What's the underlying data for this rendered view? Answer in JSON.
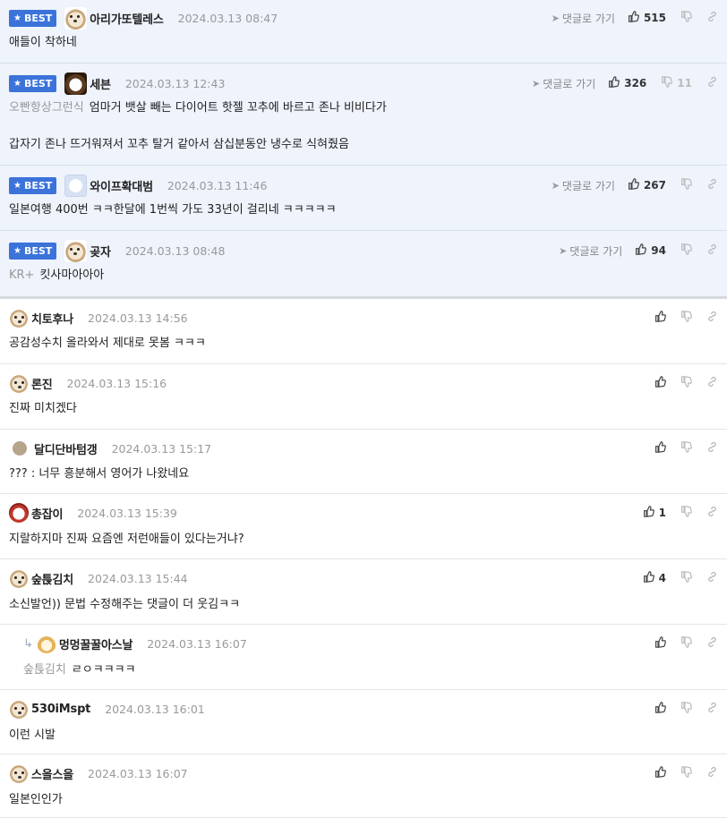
{
  "ui": {
    "best_label": "BEST",
    "goto_label": "댓글로 가기"
  },
  "comments": [
    {
      "best": true,
      "nick": "아리가또텔레스",
      "date": "2024.03.13 08:47",
      "likes": "515",
      "dislikes": "",
      "prefix": "",
      "text": "애들이 착하네",
      "text2": "",
      "avatar_icon": "dog-avatar-icon"
    },
    {
      "best": true,
      "nick": "세븐",
      "date": "2024.03.13 12:43",
      "likes": "326",
      "dislikes": "11",
      "prefix": "오빤항상그런식",
      "text": "엄마거 뱃살 빼는 다이어트 핫젤 꼬추에 바르고 존나 비비다가",
      "text2": "갑자기 존나 뜨거워져서 꼬추 탈거 같아서 삼십분동안 냉수로 식혀줬음",
      "avatar_icon": "dark-dog-avatar-icon"
    },
    {
      "best": true,
      "nick": "와이프확대범",
      "date": "2024.03.13 11:46",
      "likes": "267",
      "dislikes": "",
      "prefix": "",
      "text": "일본여행 400번 ㅋㅋ한달에 1번씩 가도 33년이 걸리네 ㅋㅋㅋㅋㅋ",
      "text2": "",
      "avatar_icon": "white-dog-avatar-icon"
    },
    {
      "best": true,
      "nick": "곶자",
      "date": "2024.03.13 08:48",
      "likes": "94",
      "dislikes": "",
      "prefix": "KR+",
      "text": "킷사마아아아",
      "text2": "",
      "avatar_icon": "dog-avatar-icon"
    },
    {
      "best": false,
      "nick": "치토후나",
      "date": "2024.03.13 14:56",
      "likes": "",
      "dislikes": "",
      "prefix": "",
      "text": "공감성수치 올라와서 제대로 못봄 ㅋㅋㅋ",
      "text2": "",
      "avatar_icon": "dog-avatar-icon"
    },
    {
      "best": false,
      "nick": "론진",
      "date": "2024.03.13 15:16",
      "likes": "",
      "dislikes": "",
      "prefix": "",
      "text": "진짜 미치겠다",
      "text2": "",
      "avatar_icon": "dog-avatar-icon"
    },
    {
      "best": false,
      "nick": "달디단바텀갱",
      "date": "2024.03.13 15:17",
      "likes": "",
      "dislikes": "",
      "prefix": "",
      "text": "??? : 너무 흥분해서 영어가 나왔네요",
      "text2": "",
      "avatar_icon": "dot-avatar-icon"
    },
    {
      "best": false,
      "nick": "총잡이",
      "date": "2024.03.13 15:39",
      "likes": "1",
      "dislikes": "",
      "prefix": "",
      "text": "지랄하지마 진짜 요즘엔 저런애들이 있다는거냐?",
      "text2": "",
      "avatar_icon": "red-dog-avatar-icon"
    },
    {
      "best": false,
      "nick": "숲튽김치",
      "date": "2024.03.13 15:44",
      "likes": "4",
      "dislikes": "",
      "prefix": "",
      "text": "소신발언)) 문법 수정해주는 댓글이 더 웃김ㅋㅋ",
      "text2": "",
      "avatar_icon": "dog-avatar-icon"
    },
    {
      "best": false,
      "reply": true,
      "nick": "멍멍꿀꿀아스날",
      "date": "2024.03.13 16:07",
      "likes": "",
      "dislikes": "",
      "prefix": "숲튽김치",
      "text": "ㄹㅇㅋㅋㅋㅋ",
      "text2": "",
      "avatar_icon": "fox-avatar-icon"
    },
    {
      "best": false,
      "nick": "530iMspt",
      "date": "2024.03.13 16:01",
      "likes": "",
      "dislikes": "",
      "prefix": "",
      "text": "이런 시발",
      "text2": "",
      "avatar_icon": "dog-avatar-icon"
    },
    {
      "best": false,
      "nick": "스을스을",
      "date": "2024.03.13 16:07",
      "likes": "",
      "dislikes": "",
      "prefix": "",
      "text": "일본인인가",
      "text2": "",
      "avatar_icon": "dog-avatar-icon"
    }
  ]
}
